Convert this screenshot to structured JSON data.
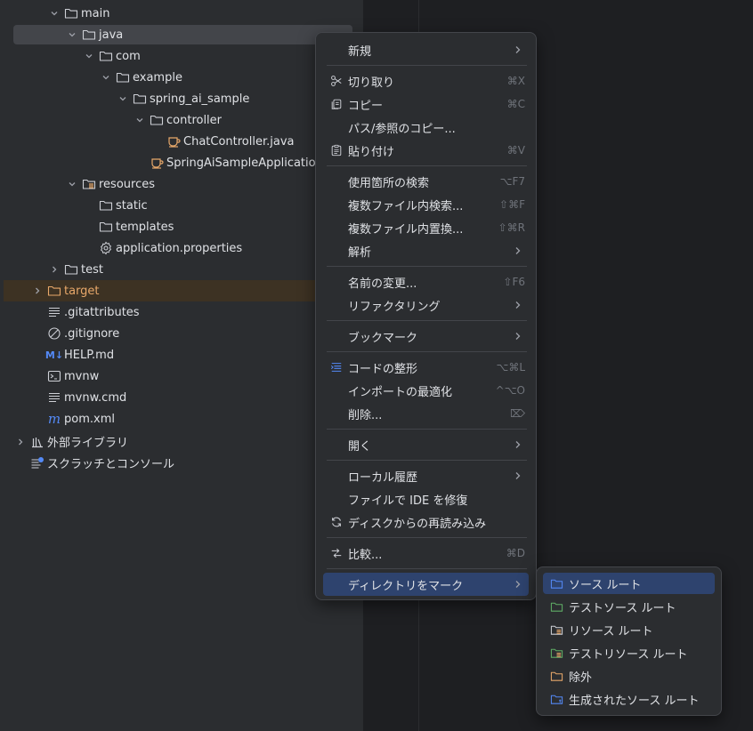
{
  "project_tree": [
    {
      "label": "main",
      "icon": "folder-icon",
      "chevron": "down",
      "selected": false
    },
    {
      "label": "java",
      "icon": "folder-icon",
      "chevron": "down",
      "selected": true
    },
    {
      "label": "com",
      "icon": "folder-icon",
      "chevron": "down"
    },
    {
      "label": "example",
      "icon": "folder-icon",
      "chevron": "down"
    },
    {
      "label": "spring_ai_sample",
      "icon": "folder-icon",
      "chevron": "down"
    },
    {
      "label": "controller",
      "icon": "folder-icon",
      "chevron": "down"
    },
    {
      "label": "ChatController.java",
      "icon": "java-class-icon",
      "chevron": "none"
    },
    {
      "label": "SpringAiSampleApplication",
      "icon": "java-class-icon",
      "chevron": "none"
    },
    {
      "label": "resources",
      "icon": "resources-folder-icon",
      "chevron": "down"
    },
    {
      "label": "static",
      "icon": "folder-icon",
      "chevron": "none"
    },
    {
      "label": "templates",
      "icon": "folder-icon",
      "chevron": "none"
    },
    {
      "label": "application.properties",
      "icon": "gear-icon",
      "chevron": "none"
    },
    {
      "label": "test",
      "icon": "folder-icon",
      "chevron": "right"
    },
    {
      "label": "target",
      "icon": "excluded-folder-icon",
      "chevron": "right",
      "excluded": true
    },
    {
      "label": ".gitattributes",
      "icon": "text-file-icon",
      "chevron": "none"
    },
    {
      "label": ".gitignore",
      "icon": "ignore-file-icon",
      "chevron": "none"
    },
    {
      "label": "HELP.md",
      "icon": "markdown-icon",
      "icon_text": "M↓",
      "chevron": "none"
    },
    {
      "label": "mvnw",
      "icon": "terminal-icon",
      "chevron": "none"
    },
    {
      "label": "mvnw.cmd",
      "icon": "text-file-icon",
      "chevron": "none"
    },
    {
      "label": "pom.xml",
      "icon": "maven-icon",
      "icon_text": "m",
      "chevron": "none"
    },
    {
      "label": "外部ライブラリ",
      "icon": "library-icon",
      "chevron": "right"
    },
    {
      "label": "スクラッチとコンソール",
      "icon": "scratch-icon",
      "chevron": "none"
    }
  ],
  "context_menu": [
    {
      "label": "新規",
      "submenu": true
    },
    {
      "separator": true
    },
    {
      "label": "切り取り",
      "icon": "scissors-icon",
      "shortcut": "⌘X"
    },
    {
      "label": "コピー",
      "icon": "copy-icon",
      "shortcut": "⌘C"
    },
    {
      "label": "パス/参照のコピー..."
    },
    {
      "label": "貼り付け",
      "icon": "paste-icon",
      "shortcut": "⌘V"
    },
    {
      "separator": true
    },
    {
      "label": "使用箇所の検索",
      "shortcut": "⌥F7"
    },
    {
      "label": "複数ファイル内検索...",
      "shortcut": "⇧⌘F"
    },
    {
      "label": "複数ファイル内置換...",
      "shortcut": "⇧⌘R"
    },
    {
      "label": "解析",
      "submenu": true
    },
    {
      "separator": true
    },
    {
      "label": "名前の変更...",
      "shortcut": "⇧F6"
    },
    {
      "label": "リファクタリング",
      "submenu": true
    },
    {
      "separator": true
    },
    {
      "label": "ブックマーク",
      "submenu": true
    },
    {
      "separator": true
    },
    {
      "label": "コードの整形",
      "icon": "reformat-icon",
      "shortcut": "⌥⌘L"
    },
    {
      "label": "インポートの最適化",
      "shortcut": "^⌥O"
    },
    {
      "label": "削除...",
      "shortcut": "⌦"
    },
    {
      "separator": true
    },
    {
      "label": "開く",
      "submenu": true
    },
    {
      "separator": true
    },
    {
      "label": "ローカル履歴",
      "submenu": true
    },
    {
      "label": "ファイルで IDE を修復"
    },
    {
      "label": "ディスクからの再読み込み",
      "icon": "reload-icon"
    },
    {
      "separator": true
    },
    {
      "label": "比較...",
      "icon": "compare-icon",
      "shortcut": "⌘D"
    },
    {
      "separator": true
    },
    {
      "label": "ディレクトリをマーク",
      "submenu": true,
      "active": true
    }
  ],
  "mark_directory_submenu": [
    {
      "label": "ソース ルート",
      "icon": "source-root-icon",
      "color": "#548af7",
      "active": true
    },
    {
      "label": "テストソース ルート",
      "icon": "test-source-root-icon",
      "color": "#5fad65"
    },
    {
      "label": "リソース ルート",
      "icon": "resources-root-icon",
      "color": "#ced0d6"
    },
    {
      "label": "テストリソース ルート",
      "icon": "test-resources-root-icon",
      "color": "#5fad65"
    },
    {
      "label": "除外",
      "icon": "excluded-icon",
      "color": "#e8a86a"
    },
    {
      "label": "生成されたソース ルート",
      "icon": "generated-source-root-icon",
      "color": "#548af7"
    }
  ],
  "colors": {
    "panel_bg": "#2b2d30",
    "editor_bg": "#1e1f22",
    "selection": "#43454a",
    "menu_active": "#2e436e",
    "folder": "#ced0d6",
    "java": "#e8a86a",
    "excluded": "#e8a86a"
  }
}
